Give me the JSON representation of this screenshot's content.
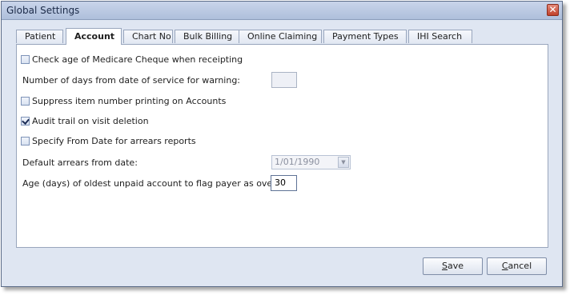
{
  "window": {
    "title": "Global Settings",
    "close_glyph": "✕"
  },
  "tabs": [
    {
      "label": "Patient"
    },
    {
      "label": "Account"
    },
    {
      "label": "Chart No"
    },
    {
      "label": "Bulk Billing"
    },
    {
      "label": "Online Claiming"
    },
    {
      "label": "Payment Types"
    },
    {
      "label": "IHI Search"
    }
  ],
  "active_tab": "Account",
  "settings": {
    "check_age_label": "Check age of Medicare Cheque when receipting",
    "check_age_checked": false,
    "days_warning_label": "Number of days from date of service for warning:",
    "days_warning_value": "",
    "suppress_item_label": "Suppress item number printing on Accounts",
    "suppress_item_checked": false,
    "audit_trail_label": "Audit trail on visit deletion",
    "audit_trail_checked": true,
    "specify_from_label": "Specify From Date for arrears reports",
    "specify_from_checked": false,
    "default_arrears_label": "Default arrears from date:",
    "default_arrears_value": "1/01/1990",
    "oldest_unpaid_label": "Age (days) of oldest unpaid account to flag payer as overdue:",
    "oldest_unpaid_value": "30"
  },
  "buttons": {
    "save_first": "S",
    "save_rest": "ave",
    "cancel_first": "C",
    "cancel_rest": "ancel"
  },
  "icons": {
    "dropdown": "chevron-down-icon",
    "close": "close-icon",
    "check": "checkmark-icon"
  }
}
